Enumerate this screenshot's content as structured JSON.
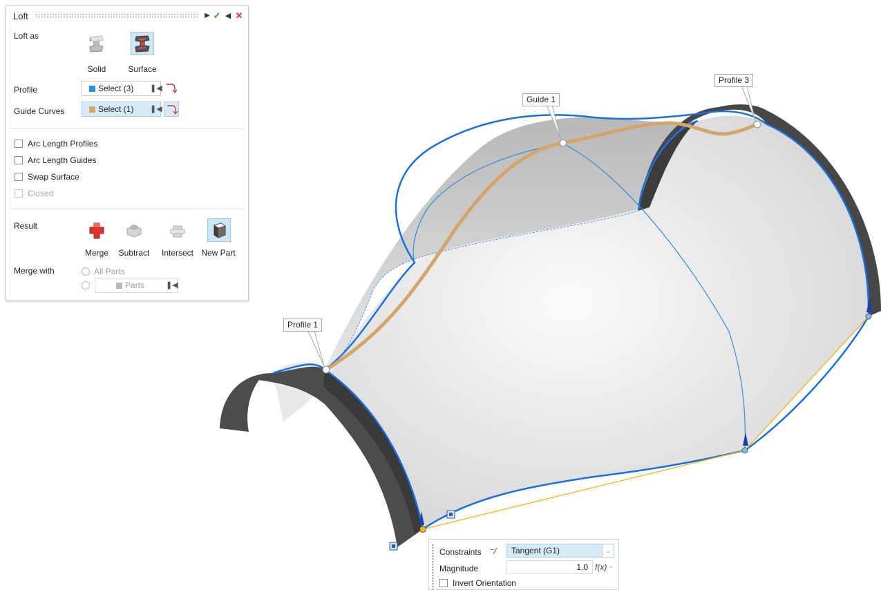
{
  "loft_panel": {
    "title": "Loft",
    "loft_as": {
      "label": "Loft as",
      "options": [
        {
          "label": "Solid",
          "selected": false
        },
        {
          "label": "Surface",
          "selected": true
        }
      ]
    },
    "profile": {
      "label": "Profile",
      "select_text": "Select (3)",
      "swatch_color": "#1e9bd7"
    },
    "guide_curves": {
      "label": "Guide Curves",
      "select_text": "Select (1)",
      "swatch_color": "#d4a56a"
    },
    "options": [
      {
        "label": "Arc Length Profiles",
        "checked": false,
        "enabled": true
      },
      {
        "label": "Arc Length Guides",
        "checked": false,
        "enabled": true
      },
      {
        "label": "Swap Surface",
        "checked": false,
        "enabled": true
      },
      {
        "label": "Closed",
        "checked": false,
        "enabled": false
      }
    ],
    "result": {
      "label": "Result",
      "options": [
        {
          "label": "Merge",
          "selected": false
        },
        {
          "label": "Subtract",
          "selected": false
        },
        {
          "label": "Intersect",
          "selected": false
        },
        {
          "label": "New Part",
          "selected": true
        }
      ]
    },
    "merge_with": {
      "label": "Merge with",
      "radio_all": "All Parts",
      "radio_parts": "Parts"
    }
  },
  "callouts": {
    "profile1": "Profile 1",
    "guide1": "Guide 1",
    "profile3": "Profile 3"
  },
  "constraints_dialog": {
    "constraints_label": "Constraints",
    "constraints_value": "Tangent (G1)",
    "magnitude_label": "Magnitude",
    "magnitude_value": "1.0",
    "fx_label": "f(x)",
    "invert_label": "Invert Orientation",
    "invert_checked": false
  },
  "colors": {
    "edge_blue": "#1a6fe0",
    "guide_tan": "#d4a56a",
    "tangent_orange": "#f5b21a",
    "surface": "#e4e4e4",
    "profile_dark": "#4a4a4a"
  }
}
